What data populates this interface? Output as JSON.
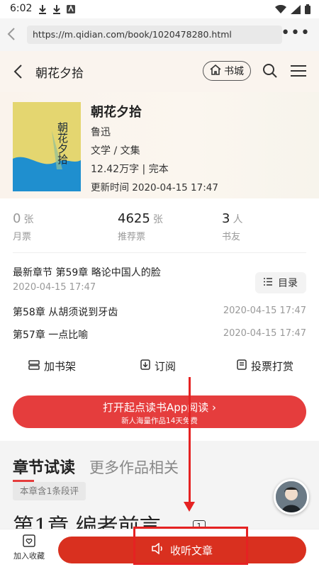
{
  "status_bar": {
    "time": "6:02"
  },
  "browser": {
    "url": "https://m.qidian.com/book/1020478280.html",
    "more_icon": "more-dots-icon"
  },
  "header": {
    "title": "朝花夕拾",
    "shelf_label": "书城"
  },
  "book": {
    "title": "朝花夕拾",
    "author": "鲁迅",
    "category": "文学 / 文集",
    "words": "12.42万字 | 完本",
    "updated": "更新时间 2020-04-15 17:47",
    "cover_title": "朝花夕拾"
  },
  "stats": [
    {
      "num": "0",
      "unit": "张",
      "label": "月票"
    },
    {
      "num": "4625",
      "unit": "张",
      "label": "推荐票"
    },
    {
      "num": "3",
      "unit": "人",
      "label": "书友"
    }
  ],
  "latest": {
    "text": "最新章节 第59章 略论中国人的脸",
    "date": "2020-04-15 17:47",
    "toc_label": "目录"
  },
  "chapters": [
    {
      "title": "第58章 从胡须说到牙齿",
      "date": "2020-04-15 17:47"
    },
    {
      "title": "第57章 一点比喻",
      "date": "2020-04-15 17:47"
    }
  ],
  "actions": {
    "add_shelf": "加书架",
    "subscribe": "订阅",
    "vote": "投票打赏"
  },
  "open_app": {
    "main": "打开起点读书App阅读 ›",
    "sub": "新人海量作品14天免费"
  },
  "preview": {
    "tab_active": "章节试读",
    "tab_more": "更多作品相关",
    "comment_badge": "本章含1条段评",
    "chapter_title": "第1章 编者前言",
    "chapter_badge": "1"
  },
  "bottom": {
    "fav_label": "加入收藏",
    "listen_label": "收听文章"
  },
  "colors": {
    "accent": "#e53d3d",
    "listen": "#d9301f",
    "annotation": "#e52222"
  }
}
